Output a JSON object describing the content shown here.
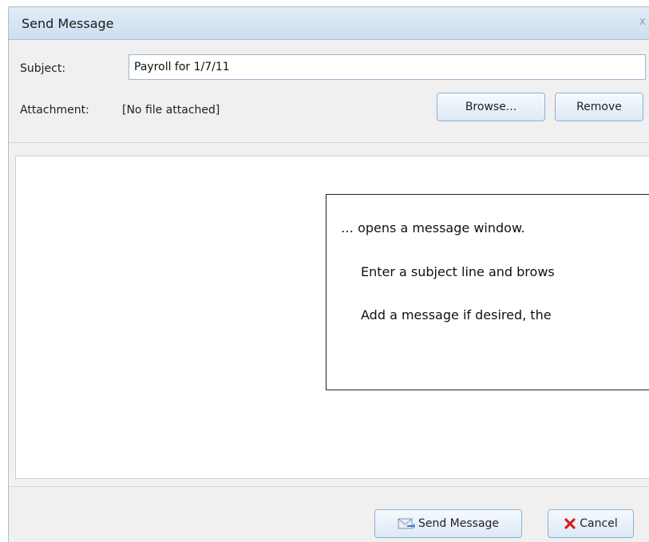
{
  "window": {
    "title": "Send Message",
    "close_glyph": "x"
  },
  "form": {
    "subject_label": "Subject:",
    "subject_value": "Payroll for 1/7/11",
    "attachment_label": "Attachment:",
    "attachment_value": "[No file attached]",
    "browse_label": "Browse...",
    "remove_label": "Remove"
  },
  "callout": {
    "line1": "… opens a message window.",
    "line2": "Enter a subject line and brows",
    "line3": "Add a message if desired, the"
  },
  "footer": {
    "send_label": "Send Message",
    "send_icon": "envelope-send-icon",
    "cancel_label": "Cancel",
    "cancel_icon": "red-x-icon"
  },
  "colors": {
    "titlebar": "#d6e5f4",
    "button_border": "#8fb0cf",
    "cancel_red": "#d42020"
  }
}
